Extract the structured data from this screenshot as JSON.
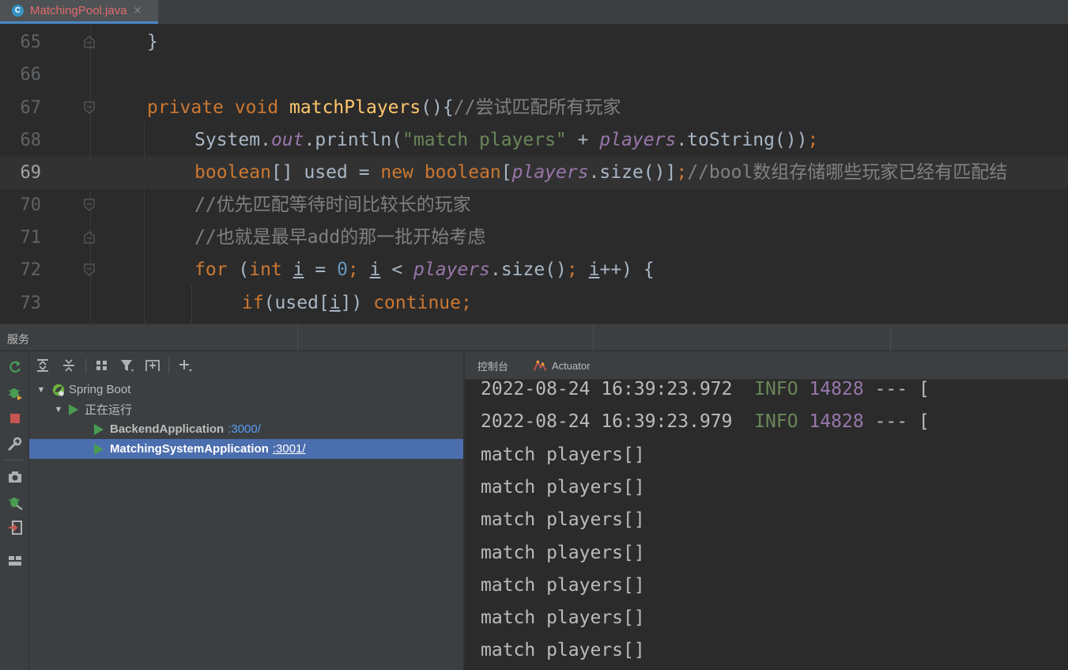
{
  "tab": {
    "icon": "java-class-icon",
    "icon_letter": "C",
    "label": "MatchingPool.java",
    "close": "×"
  },
  "editor": {
    "current_line": "69",
    "lines": [
      {
        "num": "65",
        "text": "}"
      },
      {
        "num": "66",
        "text": ""
      },
      {
        "num": "67",
        "t1": "private",
        "t2": " ",
        "t3": "void",
        "t4": " ",
        "t5": "matchPlayers",
        "t6": "(){",
        "t7": "//尝试匹配所有玩家"
      },
      {
        "num": "68",
        "t1": "System.",
        "t2": "out",
        "t3": ".println(",
        "t4": "\"match players\"",
        "t5": " + ",
        "t6": "players",
        "t7": ".toString())",
        "t8": ";"
      },
      {
        "num": "69",
        "t1": "boolean",
        "t2": "[] used = ",
        "t3": "new",
        "t4": " ",
        "t5": "boolean",
        "t6": "[",
        "t7": "players",
        "t8": ".size()]",
        "t9": ";",
        "t10": "//bool数组存储哪些玩家已经有匹配结"
      },
      {
        "num": "70",
        "text": "//优先匹配等待时间比较长的玩家"
      },
      {
        "num": "71",
        "text": "//也就是最早add的那一批开始考虑"
      },
      {
        "num": "72",
        "t1": "for",
        "t2": " (",
        "t3": "int",
        "t4": " ",
        "t5": "i",
        "t6": " = ",
        "t7": "0",
        "t8": "; ",
        "t9": "i",
        "t10": " < ",
        "t11": "players",
        "t12": ".size()",
        "t13": "; ",
        "t14": "i",
        "t15": "++) {"
      },
      {
        "num": "73",
        "t1": "if",
        "t2": "(used[",
        "t3": "i",
        "t4": "]) ",
        "t5": "continue",
        "t6": ";"
      }
    ]
  },
  "services": {
    "title": "服务",
    "tree": {
      "root": "Spring Boot",
      "group": "正在运行",
      "apps": [
        {
          "name": "BackendApplication",
          "port": ":3000/"
        },
        {
          "name": "MatchingSystemApplication",
          "port": ":3001/"
        }
      ],
      "selected_index": 1
    },
    "console_tabs": [
      {
        "label": "控制台",
        "icon": ""
      },
      {
        "label": "Actuator",
        "icon": "actuator-icon"
      }
    ],
    "console_lines": [
      {
        "ts": "2022-08-24 16:39:23.972",
        "level": "INFO",
        "pid": "14828",
        "rest": " --- ["
      },
      {
        "ts": "2022-08-24 16:39:23.979",
        "level": "INFO",
        "pid": "14828",
        "rest": " --- ["
      },
      {
        "text": "match players[]"
      },
      {
        "text": "match players[]"
      },
      {
        "text": "match players[]"
      },
      {
        "text": "match players[]"
      },
      {
        "text": "match players[]"
      },
      {
        "text": "match players[]"
      },
      {
        "text": "match players[]"
      }
    ]
  }
}
